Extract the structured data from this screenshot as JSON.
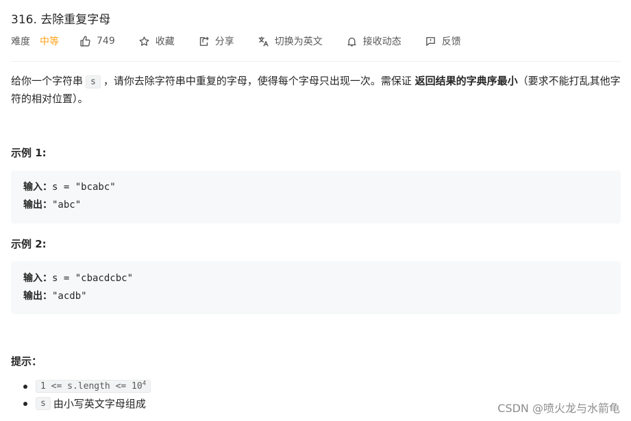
{
  "problem": {
    "title": "316. 去除重复字母",
    "difficulty_label": "难度",
    "difficulty": "中等",
    "likes": "749",
    "actions": {
      "favorite": "收藏",
      "share": "分享",
      "switch_lang": "切换为英文",
      "subscribe": "接收动态",
      "feedback": "反馈"
    }
  },
  "description": {
    "part1": "给你一个字符串",
    "code_s": "s",
    "part2": "，请你去除字符串中重复的字母，使得每个字母只出现一次。需保证",
    "bold": "返回结果的字典序最小",
    "part3": "（要求不能打乱其他字符的相对位置）。"
  },
  "examples": [
    {
      "title": "示例 1:",
      "input_label": "输入：",
      "input": "s = \"bcabc\"",
      "output_label": "输出：",
      "output": "\"abc\""
    },
    {
      "title": "示例 2:",
      "input_label": "输入：",
      "input": "s = \"cbacdcbc\"",
      "output_label": "输出：",
      "output": "\"acdb\""
    }
  ],
  "hints": {
    "title": "提示：",
    "hint1_code": "1 <= s.length <= 10",
    "hint1_sup": "4",
    "hint2_code": "s",
    "hint2_text": "由小写英文字母组成"
  },
  "watermark": "CSDN @喷火龙与水箭龟"
}
